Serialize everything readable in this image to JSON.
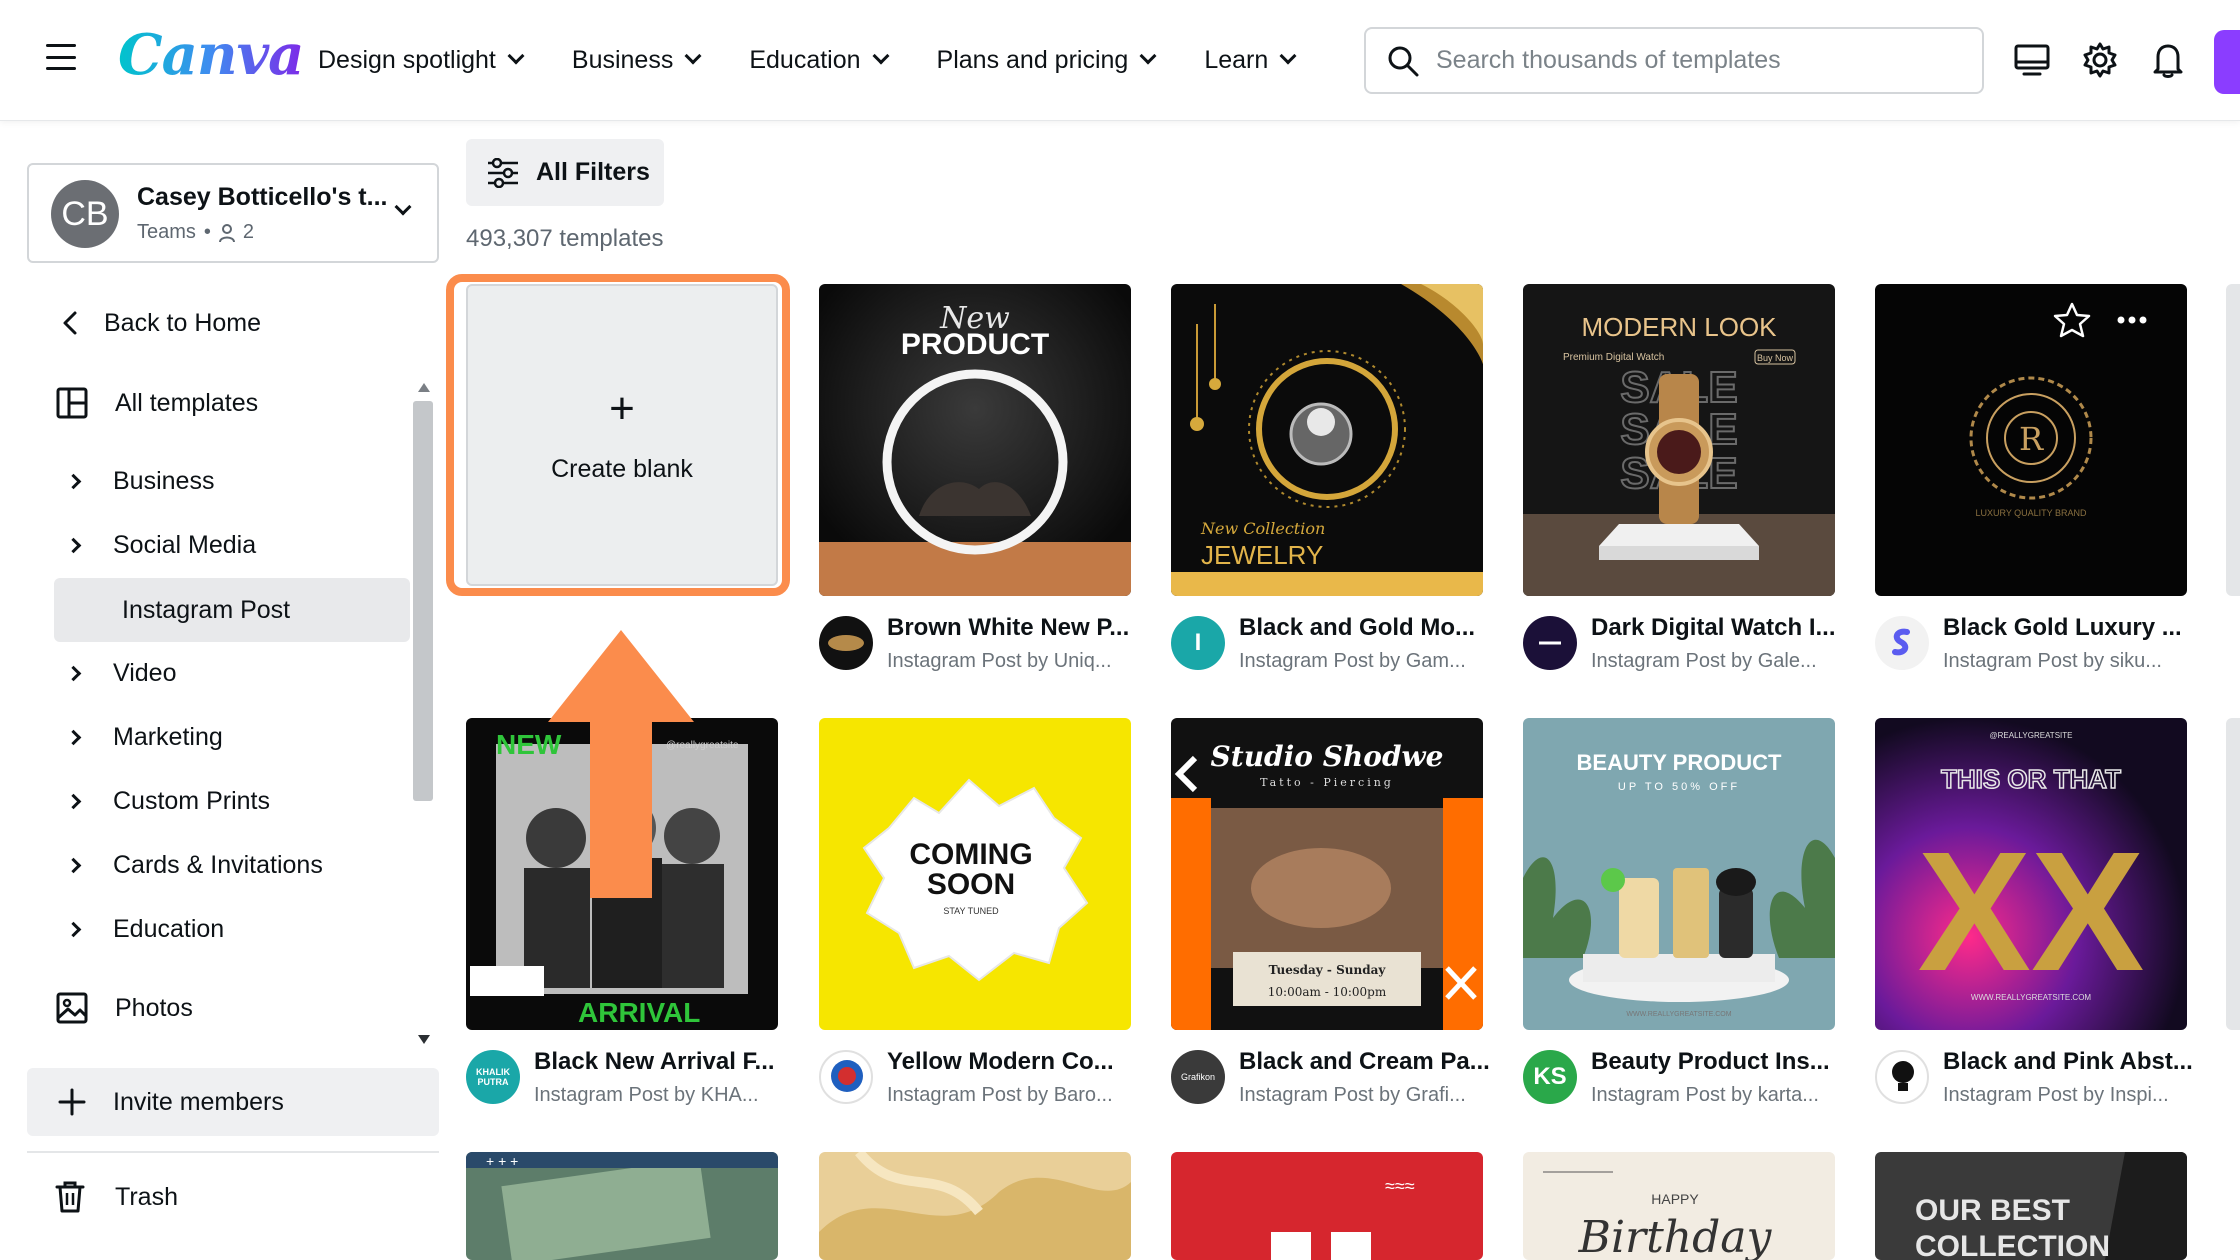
{
  "topbar": {
    "logo": "Canva",
    "nav": [
      {
        "label": "Design spotlight"
      },
      {
        "label": "Business"
      },
      {
        "label": "Education"
      },
      {
        "label": "Plans and pricing"
      },
      {
        "label": "Learn"
      }
    ],
    "search_placeholder": "Search thousands of templates",
    "accent": "#8b3dff"
  },
  "team": {
    "initials": "CB",
    "name": "Casey Botticello's t...",
    "type": "Teams",
    "members": "2"
  },
  "sidebar": {
    "back": "Back to Home",
    "all_templates": "All templates",
    "categories": [
      "Business",
      "Social Media"
    ],
    "active": "Instagram Post",
    "categories2": [
      "Video",
      "Marketing",
      "Custom Prints",
      "Cards & Invitations",
      "Education"
    ],
    "photos": "Photos",
    "invite": "Invite members",
    "trash": "Trash"
  },
  "main": {
    "filters_label": "All Filters",
    "count": "493,307 templates",
    "create_label": "Create blank",
    "highlight_color": "#fb8c4c",
    "templates": [
      {
        "title": "Brown White New P...",
        "sub": "Instagram Post by Uniq...",
        "art": [
          "New",
          "PRODUCT"
        ]
      },
      {
        "title": "Black and Gold Mo...",
        "sub": "Instagram Post by Gam...",
        "avatar": "I",
        "art": [
          "New Collection",
          "JEWELRY"
        ]
      },
      {
        "title": "Dark Digital Watch I...",
        "sub": "Instagram Post by Gale...",
        "art": [
          "MODERN LOOK",
          "Premium Digital Watch",
          "Buy Now",
          "SALE"
        ]
      },
      {
        "title": "Black Gold Luxury ...",
        "sub": "Instagram Post by siku...",
        "art": [
          "R",
          "LUXURY QUALITY BRAND"
        ]
      },
      {
        "title": "Black New Arrival F...",
        "sub": "Instagram Post by KHA...",
        "avatar": "KHALIK PUTRA",
        "art": [
          "NEW",
          "@reallygreatsite",
          "ARRIVAL"
        ]
      },
      {
        "title": "Yellow Modern Co...",
        "sub": "Instagram Post by Baro...",
        "art": [
          "COMING",
          "SOON",
          "STAY TUNED"
        ]
      },
      {
        "title": "Black and Cream Pa...",
        "sub": "Instagram Post by Grafi...",
        "avatar": "Grafikon",
        "art": [
          "Studio Shodwe",
          "Tatto - Piercing",
          "Tuesday - Sunday",
          "10:00am - 10:00pm"
        ]
      },
      {
        "title": "Beauty Product Ins...",
        "sub": "Instagram Post by karta...",
        "avatar": "KS",
        "art": [
          "BEAUTY PRODUCT",
          "UP TO 50% OFF",
          "WWW.REALLYGREATSITE.COM"
        ]
      },
      {
        "title": "Black and Pink Abst...",
        "sub": "Instagram Post by Inspi...",
        "art": [
          "@REALLYGREATSITE",
          "THIS OR THAT",
          "XX",
          "WWW.REALLYGREATSITE.COM"
        ]
      }
    ],
    "row3_art": [
      "HAPPY",
      "Birthday",
      "OUR BEST",
      "COLLECTION"
    ]
  }
}
